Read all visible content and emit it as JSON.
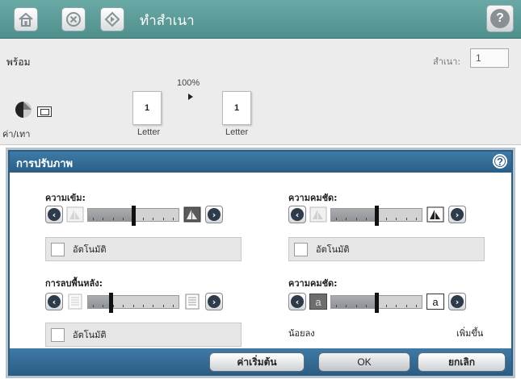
{
  "titlebar": {
    "title": "ทำสำเนา",
    "home_icon": "home-icon",
    "stop_icon": "stop-icon",
    "start_icon": "start-icon",
    "help_icon": "help-icon"
  },
  "status": {
    "ready_text": "พร้อม",
    "copies_label": "สำเนา:",
    "copies_value": "1",
    "zoom": "100%",
    "original": {
      "pages": "1",
      "size": "Letter"
    },
    "output": {
      "pages": "1",
      "size": "Letter"
    },
    "darkness_label": "ค่า/เทา"
  },
  "dialog": {
    "title": "การปรับภาพ",
    "darkness": {
      "label": "ความเข้ม:",
      "level": 0.5,
      "auto_label": "อัตโนมัติ"
    },
    "sharpness": {
      "label": "ความคมชัด:",
      "level": 0.5,
      "auto_label": "อัตโนมัติ"
    },
    "background": {
      "label": "การลบพื้นหลัง:",
      "level": 0.25,
      "auto_label": "อัตโนมัติ"
    },
    "contrast": {
      "label": "ความคมชัด:",
      "level": 0.5,
      "min_label": "น้อยลง",
      "max_label": "เพิ่มขึ้น",
      "glyph": "a"
    },
    "buttons": {
      "defaults": "ค่าเริ่มต้น",
      "ok": "OK",
      "cancel": "ยกเลิก"
    }
  },
  "colors": {
    "titlebar": "#5a9996",
    "dialog_header": "#2f6690",
    "panel": "#ececec"
  }
}
